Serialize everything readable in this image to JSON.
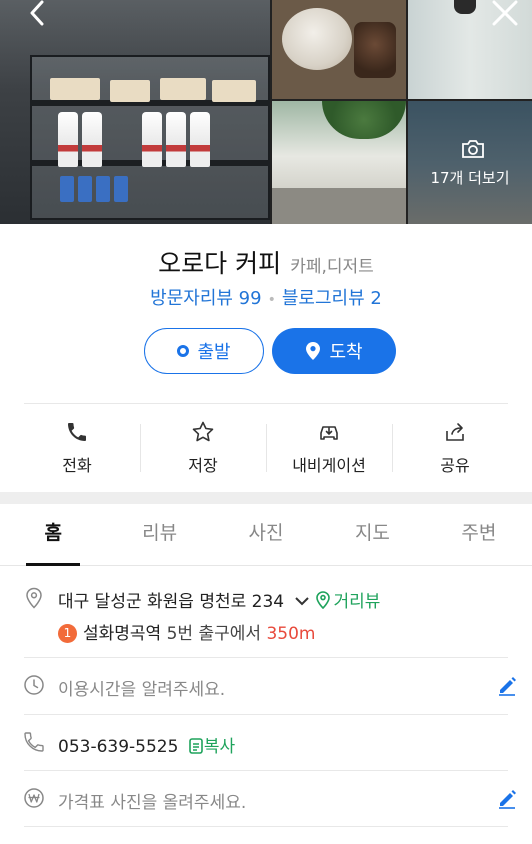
{
  "gallery": {
    "more_photos_label": "17개 더보기"
  },
  "place": {
    "name": "오로다 커피",
    "category": "카페,디저트",
    "visitor_review_label": "방문자리뷰 99",
    "blog_review_label": "블로그리뷰 2"
  },
  "route": {
    "depart_label": "출발",
    "arrive_label": "도착"
  },
  "actions": [
    {
      "label": "전화",
      "icon": "phone-icon"
    },
    {
      "label": "저장",
      "icon": "star-icon"
    },
    {
      "label": "내비게이션",
      "icon": "car-icon"
    },
    {
      "label": "공유",
      "icon": "share-icon"
    }
  ],
  "tabs": [
    {
      "label": "홈",
      "active": true
    },
    {
      "label": "리뷰",
      "active": false
    },
    {
      "label": "사진",
      "active": false
    },
    {
      "label": "지도",
      "active": false
    },
    {
      "label": "주변",
      "active": false
    }
  ],
  "info": {
    "address": "대구 달성군 화원읍 명천로 234",
    "street_view_label": "거리뷰",
    "subway_line_number": "1",
    "subway_station": "설화명곡역",
    "subway_exit": "5번 출구에서",
    "subway_distance": "350m",
    "hours_prompt": "이용시간을 알려주세요.",
    "phone": "053-639-5525",
    "copy_label": "복사",
    "price_prompt": "가격표 사진을 올려주세요."
  },
  "colors": {
    "accent_blue": "#1a73e8",
    "link_blue": "#2275d7",
    "green": "#1fa35c",
    "red": "#e84a3c",
    "line_badge": "#f26b3a"
  }
}
